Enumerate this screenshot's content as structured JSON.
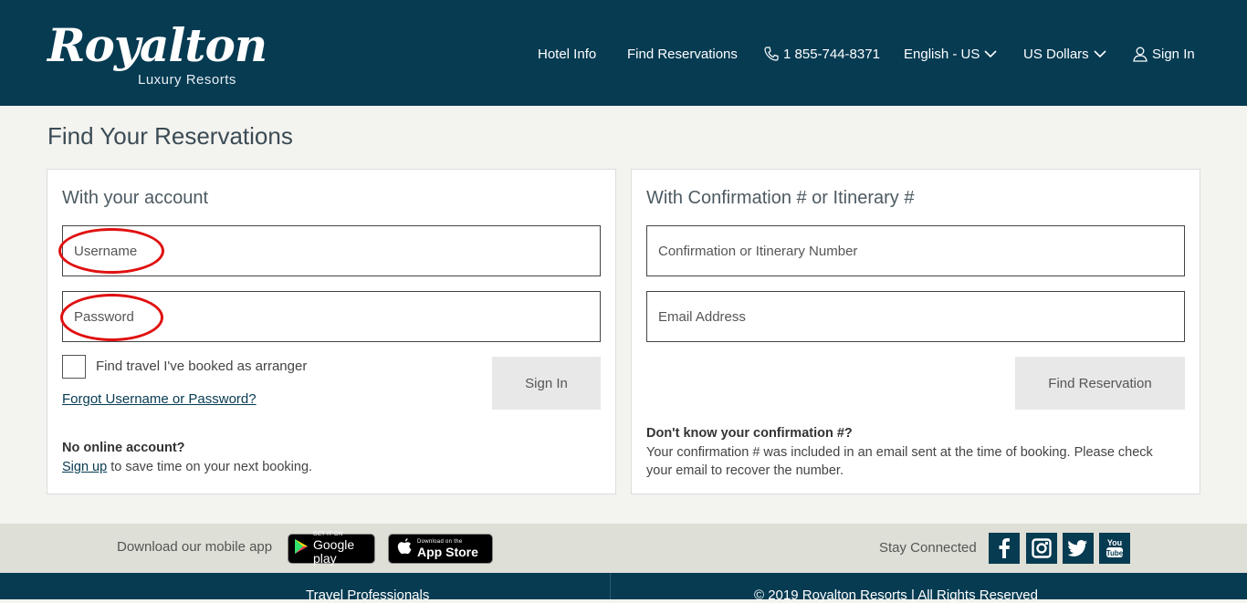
{
  "brand": {
    "logo_script": "Royalton",
    "logo_sub": "Luxury Resorts"
  },
  "nav": {
    "hotel_info": "Hotel Info",
    "find_reservations": "Find Reservations",
    "phone": "1 855-744-8371",
    "language": "English - US",
    "currency": "US Dollars",
    "sign_in": "Sign In"
  },
  "page": {
    "title": "Find Your Reservations"
  },
  "account_panel": {
    "title": "With your account",
    "username_placeholder": "Username",
    "password_placeholder": "Password",
    "arranger_label": "Find travel I've booked as arranger",
    "forgot_link": "Forgot Username or Password?",
    "sign_in_button": "Sign In",
    "no_account_heading": "No online account?",
    "sign_up_link": "Sign up",
    "sign_up_suffix": " to save time on your next booking."
  },
  "confirmation_panel": {
    "title": "With Confirmation # or Itinerary #",
    "confirmation_placeholder": "Confirmation or Itinerary Number",
    "email_placeholder": "Email Address",
    "find_button": "Find Reservation",
    "help_heading": "Don't know your confirmation #?",
    "help_line1": "Your confirmation # was included in an email sent at the time of booking. Please check",
    "help_line2": "your email to recover the number."
  },
  "app_strip": {
    "download_text": "Download our mobile app",
    "google_small": "GET IT ON",
    "google_big": "Google play",
    "apple_small": "Download on the",
    "apple_big": "App Store",
    "stay_connected": "Stay Connected",
    "social_icons": [
      "facebook-icon",
      "instagram-icon",
      "twitter-icon",
      "youtube-icon"
    ]
  },
  "footer": {
    "travel_professionals": "Travel Professionals",
    "copyright": "© 2019 Royalton Resorts | All Rights Reserved"
  },
  "colors": {
    "brand_navy": "#063b52",
    "annotation_red": "#e01010",
    "page_bg": "#f3f3ef"
  }
}
